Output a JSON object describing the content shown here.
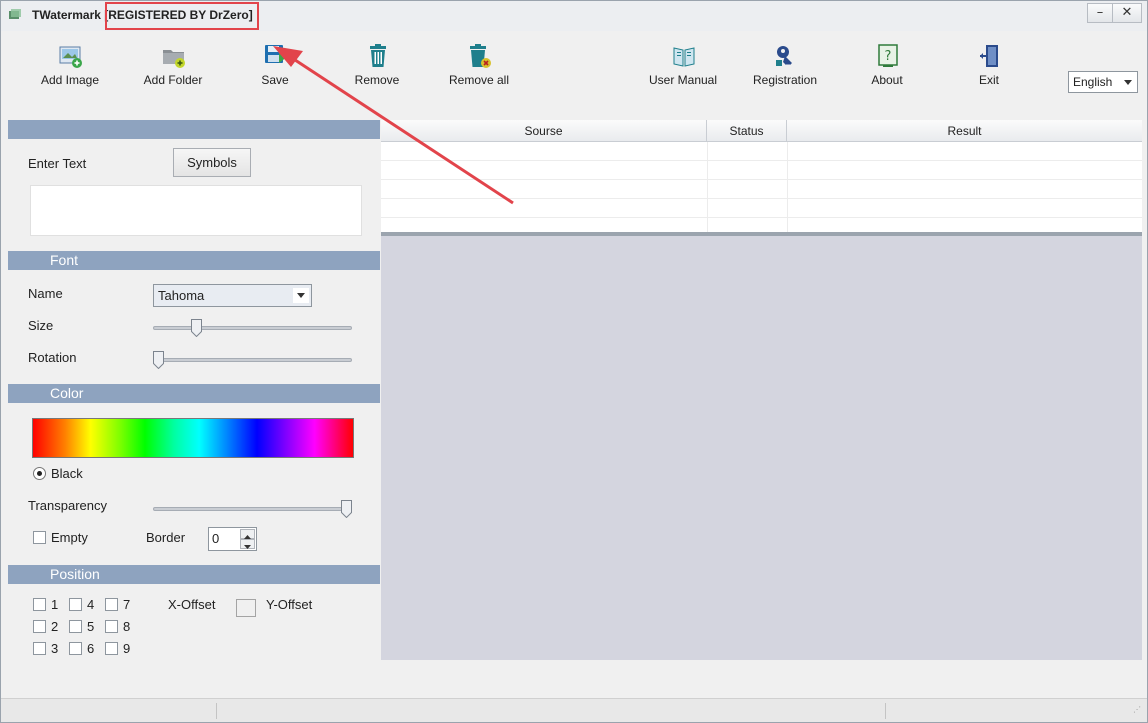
{
  "window": {
    "title": "TWatermark [REGISTERED BY DrZero]",
    "controls": {
      "minimize": "–",
      "close": "✕"
    }
  },
  "toolbar": {
    "items": [
      {
        "label": "Add Image",
        "icon": "add-image-icon"
      },
      {
        "label": "Add Folder",
        "icon": "add-folder-icon"
      },
      {
        "label": "Save",
        "icon": "save-icon"
      },
      {
        "label": "Remove",
        "icon": "trash-icon"
      },
      {
        "label": "Remove all",
        "icon": "trash-remove-all-icon"
      },
      {
        "label": "User Manual",
        "icon": "book-icon"
      },
      {
        "label": "Registration",
        "icon": "key-icon"
      },
      {
        "label": "About",
        "icon": "help-icon"
      },
      {
        "label": "Exit",
        "icon": "exit-door-icon"
      }
    ],
    "language": "English"
  },
  "text_panel": {
    "enter_text_label": "Enter Text",
    "symbols_button": "Symbols",
    "text_value": ""
  },
  "font_panel": {
    "header": "Font",
    "name_label": "Name",
    "name_value": "Tahoma",
    "size_label": "Size",
    "size_level": 0.2,
    "rotation_label": "Rotation",
    "rotation_level": 0.0
  },
  "color_panel": {
    "header": "Color",
    "black_label": "Black",
    "black_selected": true,
    "transparency_label": "Transparency",
    "transparency_level": 1.0,
    "empty_label": "Empty",
    "border_label": "Border",
    "border_value": "0"
  },
  "position_panel": {
    "header": "Position",
    "positions": [
      "1",
      "2",
      "3",
      "4",
      "5",
      "6",
      "7",
      "8",
      "9"
    ],
    "x_offset_label": "X-Offset",
    "y_offset_label": "Y-Offset"
  },
  "file_table": {
    "columns": [
      "Sourse",
      "Status",
      "Result"
    ],
    "rows": []
  },
  "colors": {
    "section_band": "#8ea3bf",
    "preview_bg": "#d4d5df",
    "annotation_red": "#e2444b",
    "icon_teal": "#1f7f8c",
    "icon_navy": "#2b4b8c"
  }
}
